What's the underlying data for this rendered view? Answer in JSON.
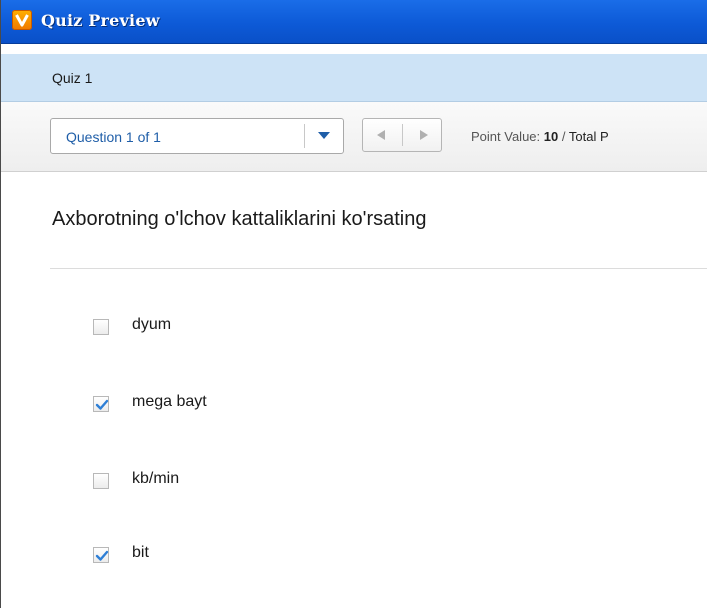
{
  "window": {
    "title": "Quiz Preview",
    "icon": "quiz-app-icon"
  },
  "quiz": {
    "name": "Quiz 1"
  },
  "toolbar": {
    "question_selector": "Question 1 of 1",
    "prev_icon": "triangle-left-icon",
    "next_icon": "triangle-right-icon",
    "point_value_label": "Point Value:",
    "point_value": "10",
    "separator": "/",
    "total_label": "Total P"
  },
  "question": {
    "text": "Axborotning o'lchov kattaliklarini ko'rsating",
    "options": [
      {
        "label": "dyum",
        "checked": false
      },
      {
        "label": "mega bayt",
        "checked": true
      },
      {
        "label": "kb/min",
        "checked": false
      },
      {
        "label": "bit",
        "checked": true
      }
    ]
  },
  "colors": {
    "titlebar": "#0d5ad7",
    "quiz_bar": "#cde3f6",
    "link_blue": "#1f5ea8",
    "check_blue": "#2e7fd6"
  }
}
